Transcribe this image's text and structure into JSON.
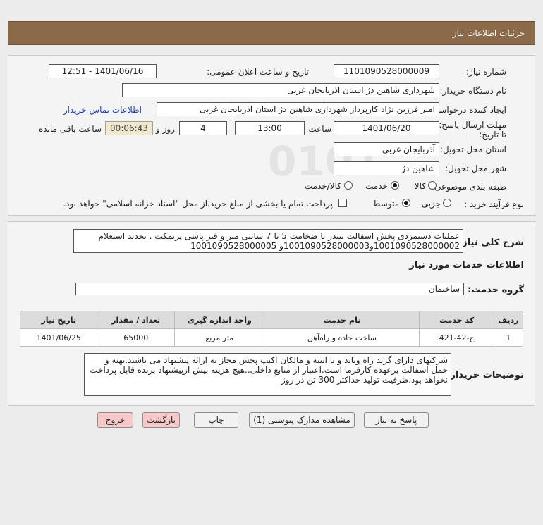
{
  "header": {
    "title": "جزئیات اطلاعات نیاز"
  },
  "form": {
    "need_number_label": "شماره نیاز:",
    "need_number": "1101090528000009",
    "announce_label": "تاریخ و ساعت اعلان عمومی:",
    "announce_value": "1401/06/16 - 12:51",
    "buyer_org_label": "نام دستگاه خریدار:",
    "buyer_org": "شهرداری شاهین دژ استان اذربایجان غربی",
    "requester_label": "ایجاد کننده درخواست:",
    "requester": "امیر فرزین نژاد کارپرداز شهرداری شاهین دژ استان اذربایجان غربی",
    "contact_link": "اطلاعات تماس خریدار",
    "deadline_label": "مهلت ارسال پاسخ: تا تاریخ:",
    "deadline_date": "1401/06/20",
    "time_label": "ساعت",
    "deadline_time": "13:00",
    "days_label": "روز و",
    "days": "4",
    "remaining": "00:06:43",
    "remaining_label": "ساعت باقی مانده",
    "province_label": "استان محل تحویل:",
    "province": "آذربایجان غربی",
    "city_label": "شهر محل تحویل:",
    "city": "شاهین دژ",
    "category_label": "طبقه بندی موضوعی:",
    "category_options": [
      "کالا",
      "خدمت",
      "کالا/خدمت"
    ],
    "process_label": "نوع فرآیند خرید :",
    "process_options": [
      "جزیی",
      "متوسط"
    ],
    "payment_note": "پرداخت تمام یا بخشی از مبلغ خرید،از محل \"اسناد خزانه اسلامی\" خواهد بود."
  },
  "details": {
    "summary_label": "شرح کلی نیاز:",
    "summary": "عملیات دستمزدی پخش اسفالت بیندر با ضخامت 5 تا 7 سانتی متر و قیر پاشی پریمکت . تجدید استعلام 1001090528000002و1001090528000003و 1001090528000005",
    "services_title": "اطلاعات خدمات مورد نیاز",
    "service_group_label": "گروه خدمت:",
    "service_group": "ساختمان",
    "table_headers": [
      "ردیف",
      "کد خدمت",
      "نام خدمت",
      "واحد اندازه گیری",
      "تعداد / مقدار",
      "تاریخ نیاز"
    ],
    "rows": [
      [
        "1",
        "ج-42-421",
        "ساخت جاده و راه‌آهن",
        "متر مربع",
        "65000",
        "1401/06/25"
      ]
    ],
    "buyer_notes_label": "توضیحات خریدار:",
    "buyer_notes": "شرکتهای دارای گرید راه وباند و یا ابنیه و مالکان اکیپ پخش مجاز به ارائه پیشنهاد می باشند.تهیه و حمل اسفالت برعهده کارفرما است.اعتبار از منابع داخلی..هیچ هزینه بیش ازپیشنهاد برنده قابل پرداخت نخواهد بود.ظرفیت تولید حداکثر 300 تن در روز"
  },
  "buttons": {
    "reply": "پاسخ به نیاز",
    "docs": "مشاهده مدارک پیوستی (1)",
    "print": "چاپ",
    "back": "بازگشت",
    "exit": "خروج"
  }
}
